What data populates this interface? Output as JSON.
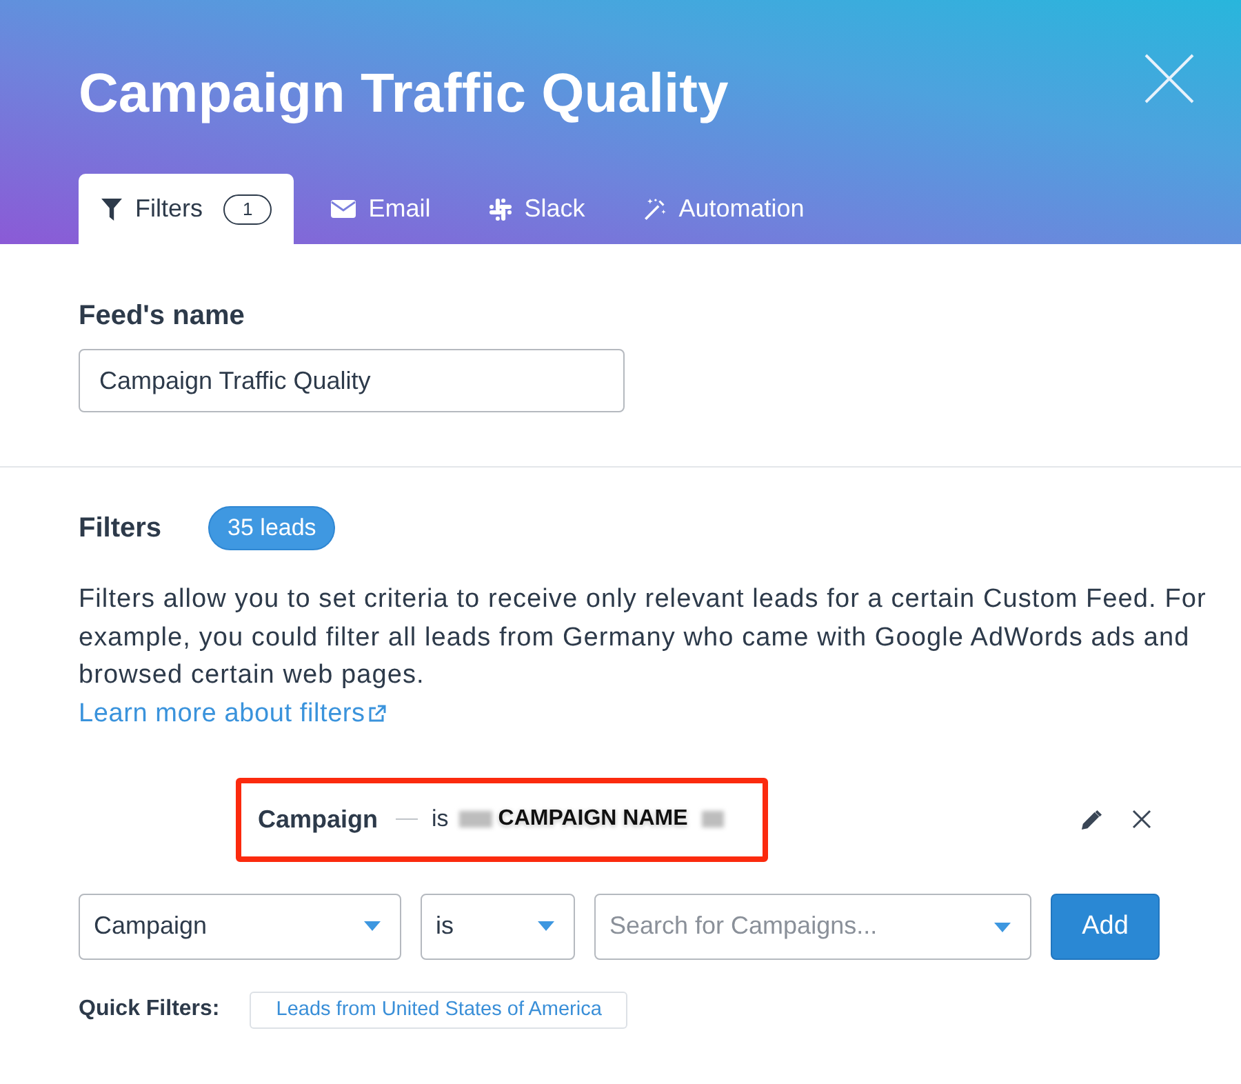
{
  "dialog": {
    "title": "Campaign Traffic Quality"
  },
  "tabs": [
    {
      "kind": "filter",
      "label": "Filters",
      "badge": "1",
      "selected": true
    },
    {
      "kind": "email",
      "label": "Email",
      "selected": false
    },
    {
      "kind": "slack",
      "label": "Slack",
      "selected": false
    },
    {
      "kind": "automation",
      "label": "Automation",
      "selected": false
    }
  ],
  "feed_name": {
    "label": "Feed's name",
    "value": "Campaign Traffic Quality"
  },
  "filters": {
    "heading": "Filters",
    "lead_count": "35 leads",
    "description": "Filters allow you to set criteria to receive only relevant leads for a certain Custom Feed. For example, you could filter all leads from Germany who came with Google AdWords ads and browsed certain web pages.",
    "link": "Learn more about filters",
    "active_filters": [
      {
        "field": "Campaign",
        "separator": "—",
        "operator": "is",
        "value": "CAMPAIGN NAME",
        "redacted": true,
        "highlighted": true
      }
    ],
    "new_filter": {
      "field": "Campaign",
      "operator": "is",
      "search_placeholder": "Search for Campaigns...",
      "add_button": "Add"
    },
    "quick_filters": {
      "label": "Quick Filters:",
      "items": [
        "Leads from United States of America"
      ]
    }
  }
}
